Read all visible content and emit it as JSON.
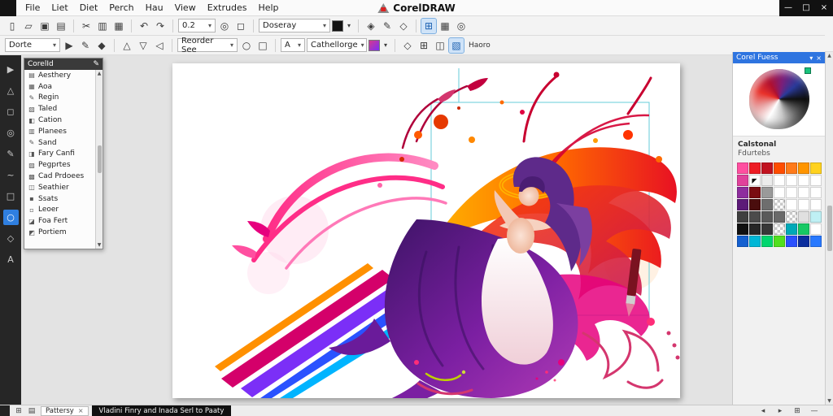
{
  "app": {
    "title": "CorelDRAW"
  },
  "glyphs": {
    "dropdown": "▾",
    "up": "▲",
    "down": "▼"
  },
  "window_controls": [
    [
      "—",
      "minimize-button",
      0
    ],
    [
      "□",
      "maximize-button",
      0
    ],
    [
      "×",
      "close-button",
      0
    ]
  ],
  "menus": [
    "File",
    "Liet",
    "Diet",
    "Perch",
    "Hau",
    "View",
    "Extrudes",
    "Help"
  ],
  "toolbar1": {
    "g1": [
      [
        "▯",
        "new-doc-icon",
        0
      ],
      [
        "▱",
        "open-icon",
        0
      ],
      [
        "▣",
        "save-icon",
        0
      ],
      [
        "▤",
        "print-icon",
        0
      ]
    ],
    "g2": [
      [
        "✂",
        "cut-icon",
        0
      ],
      [
        "▥",
        "copy-icon",
        0
      ],
      [
        "▦",
        "paste-icon",
        0
      ]
    ],
    "g3": [
      [
        "↶",
        "undo-icon",
        0
      ],
      [
        "↷",
        "redo-icon",
        0
      ]
    ],
    "zoom_value": "0.2",
    "g4": [
      [
        "◎",
        "zoom-tool-icon",
        0
      ],
      [
        "◻",
        "pan-tool-icon",
        0
      ]
    ],
    "view_dropdown": "Doseray",
    "outline_chip_color": "#111111",
    "g5": [
      [
        "◈",
        "snap-options-icon",
        0
      ],
      [
        "✎",
        "edit-mode-icon",
        0
      ],
      [
        "◇",
        "wireframe-icon",
        0
      ]
    ],
    "g6": [
      [
        "⊞",
        "grid-toggle-icon",
        1
      ],
      [
        "▦",
        "guidelines-icon",
        0
      ],
      [
        "◎",
        "rulers-icon",
        0
      ]
    ]
  },
  "toolbar2": {
    "object_combo": "Dorte",
    "g1": [
      [
        "▶",
        "pick-tool-icon",
        0
      ],
      [
        "✎",
        "pen-icon",
        0
      ],
      [
        "◆",
        "fill-tool-icon",
        0
      ]
    ],
    "g2": [
      [
        "△",
        "rotate-left-icon",
        0
      ],
      [
        "▽",
        "rotate-right-icon",
        0
      ],
      [
        "◁",
        "mirror-icon",
        0
      ]
    ],
    "size_dropdown": "Reorder  See",
    "g3": [
      [
        "○",
        "ellipse-icon",
        0
      ],
      [
        "□",
        "rect-icon",
        0
      ]
    ],
    "font_dropdown_label": "A",
    "style_dropdown": "Cathellorge",
    "fill_chip_color": "#d43a8e",
    "g4": [
      [
        "◇",
        "outline-options-icon",
        0
      ],
      [
        "⊞",
        "transparency-icon",
        0
      ],
      [
        "◫",
        "order-icon",
        0
      ],
      [
        "▧",
        "effects-icon",
        1
      ]
    ],
    "right_label": "Haoro"
  },
  "toolbox": {
    "tools": [
      [
        "▶",
        "pick-tool",
        0
      ],
      [
        "△",
        "shape-tool",
        0
      ],
      [
        "◻",
        "crop-tool",
        0
      ],
      [
        "◎",
        "zoom-tool",
        0
      ],
      [
        "✎",
        "freehand-tool",
        0
      ],
      [
        "~",
        "artistic-media-tool",
        0
      ],
      [
        "□",
        "rectangle-tool",
        0
      ],
      [
        "○",
        "ellipse-tool",
        1
      ],
      [
        "◇",
        "polygon-tool",
        0
      ],
      [
        "A",
        "text-tool",
        0
      ]
    ]
  },
  "docker": {
    "title": "CorelId",
    "header_icon": "✎",
    "items": [
      [
        "▤",
        "Aesthery"
      ],
      [
        "▦",
        "Aoa"
      ],
      [
        "✎",
        "Regin"
      ],
      [
        "▧",
        "Taled"
      ],
      [
        "◧",
        "Cation"
      ],
      [
        "▥",
        "Planees"
      ],
      [
        "✎",
        "Sand"
      ],
      [
        "◨",
        "Fary Canfi"
      ],
      [
        "▨",
        "Pegprtes"
      ],
      [
        "▩",
        "Cad Prdoees"
      ],
      [
        "◫",
        "Seathier"
      ],
      [
        "▪",
        "Ssats"
      ],
      [
        "▫",
        "Leoer"
      ],
      [
        "◪",
        "Foa Fert"
      ],
      [
        "◩",
        "Portiem"
      ]
    ]
  },
  "right_panel": {
    "title": "Corel Fuess",
    "header_icons": [
      [
        "▾",
        "rollup-icon",
        0
      ],
      [
        "×",
        "close-docker-icon",
        0
      ]
    ],
    "labels": {
      "primary": "Calstonal",
      "secondary": "Fdurtebs"
    },
    "wheel_colors": [
      "#e8312a",
      "#b01030",
      "#7a1f7a",
      "#2a3a9a",
      "#101010",
      "#6a6a6a",
      "#ffffff"
    ],
    "marker_color": "#19c37d",
    "palette_rows": [
      [
        "#ff4fa0",
        "#ed1c24",
        "#c1121f",
        "#ff4d00",
        "#ff7a1a",
        "#ff9500",
        "#ffd21f"
      ],
      [
        "#e0419b",
        "cursor",
        "#ececec",
        "#ffffff",
        "#ffffff",
        "#ffffff",
        "#ffffff"
      ],
      [
        "#8e2d9e",
        "#7a0c12",
        "#9a9a9a",
        "#ffffff",
        "#ffffff",
        "#ffffff",
        "#ffffff"
      ],
      [
        "#5c1a78",
        "#4a0d0d",
        "#6e6e6e",
        "checker",
        "#ffffff",
        "#ffffff",
        "#ffffff"
      ],
      [
        "#3f3f3f",
        "#4b4b4b",
        "#5a5a5a",
        "#6a6a6a",
        "checker",
        "#e0e0e0",
        "#bff0f4"
      ],
      [
        "#101010",
        "#262626",
        "#383838",
        "checker",
        "#00a9b8",
        "#17c964",
        "#ffffff"
      ],
      [
        "#1460d0",
        "#00b7d6",
        "#00d66e",
        "#52e01f",
        "#2b50ff",
        "#0c2e9e",
        "#2979ff"
      ]
    ]
  },
  "statusbar": {
    "left_icons": [
      [
        "⊞",
        "pages-icon",
        0
      ],
      [
        "▤",
        "layers-icon",
        0
      ]
    ],
    "tab": {
      "label": "Pattersy",
      "close": "×"
    },
    "message": "Vladini Finry and Inada Serl to Paaty",
    "right_icons": [
      [
        "◂",
        "prev-page-icon",
        0
      ],
      [
        "▸",
        "next-page-icon",
        0
      ],
      [
        "⊞",
        "add-page-icon",
        0
      ],
      [
        "—",
        "divider-icon",
        0
      ]
    ]
  },
  "artwork_colors": {
    "flame": [
      "#ffb300",
      "#ff6a00",
      "#e81123"
    ],
    "dress": [
      "#3d1466",
      "#7b1fa2",
      "#b03ab5"
    ],
    "pink": "#ff2d87",
    "magenta": "#e6007e",
    "streaks": [
      "#ff9000",
      "#d4006a",
      "#7b2ff7",
      "#2a52ff",
      "#00b4ff"
    ],
    "guide": "#54c6d6"
  }
}
